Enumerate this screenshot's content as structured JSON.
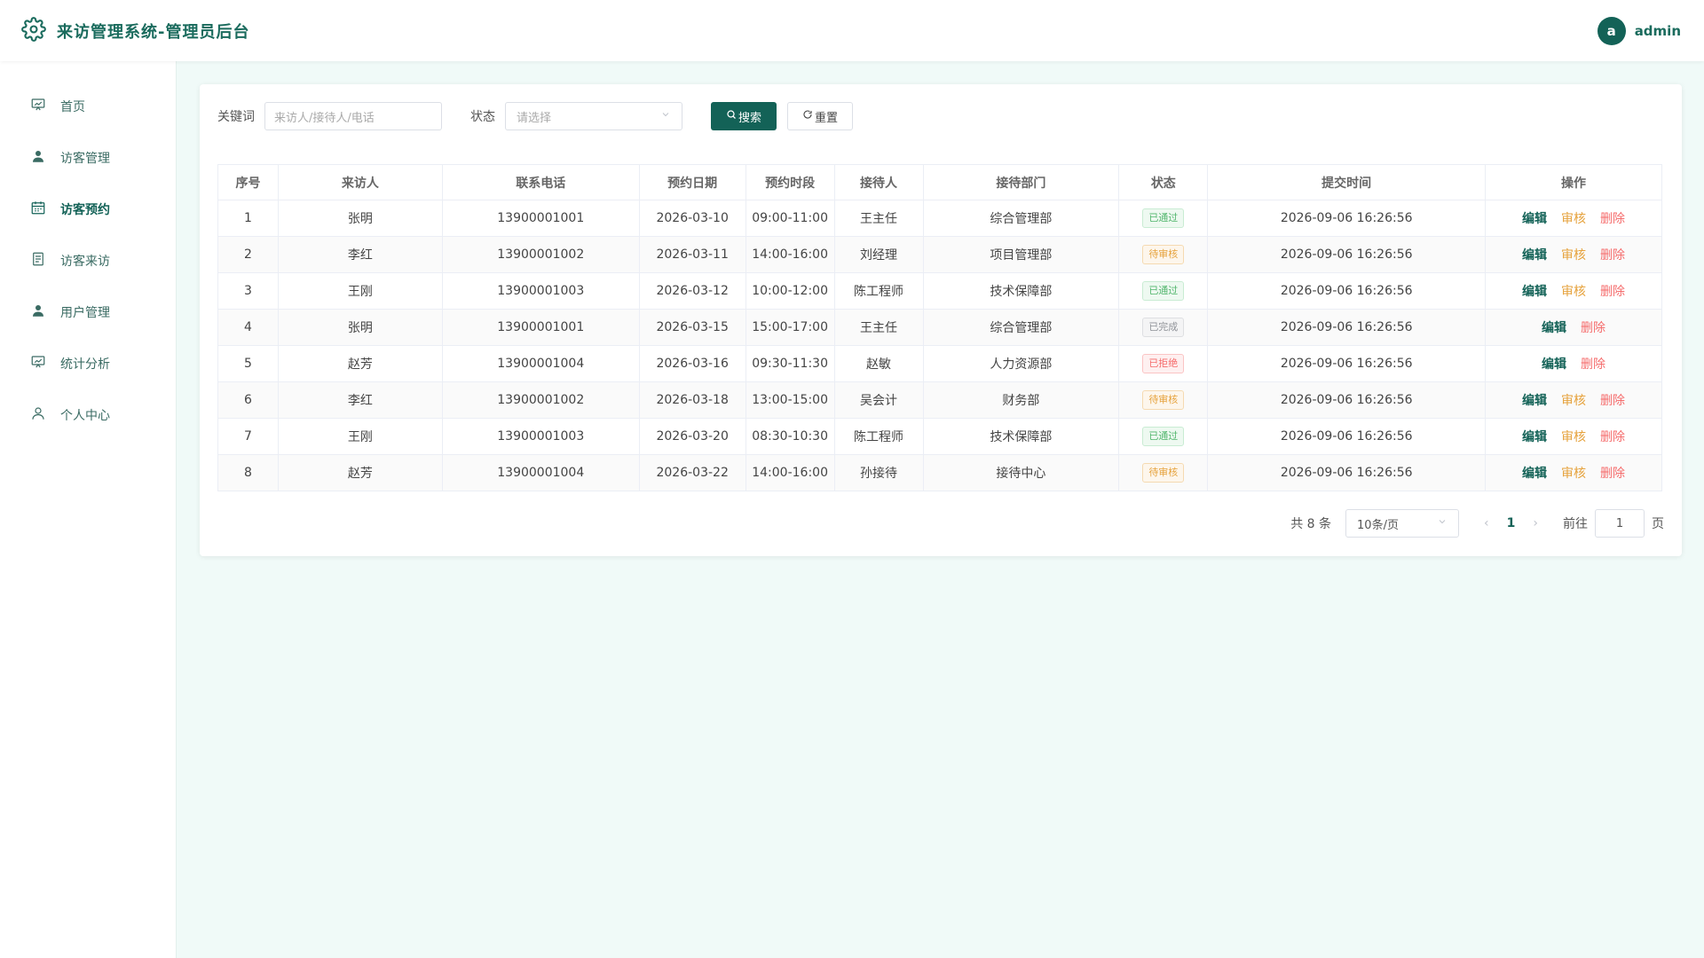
{
  "header": {
    "title": "来访管理系统-管理员后台",
    "avatar_letter": "a",
    "username": "admin"
  },
  "sidebar": {
    "items": [
      {
        "label": "首页",
        "icon": "dashboard-icon"
      },
      {
        "label": "访客管理",
        "icon": "user-icon"
      },
      {
        "label": "访客预约",
        "icon": "calendar-icon",
        "active": true
      },
      {
        "label": "访客来访",
        "icon": "document-icon"
      },
      {
        "label": "用户管理",
        "icon": "user-icon"
      },
      {
        "label": "统计分析",
        "icon": "chart-icon"
      },
      {
        "label": "个人中心",
        "icon": "profile-icon"
      }
    ]
  },
  "filters": {
    "keyword_label": "关键词",
    "keyword_placeholder": "来访人/接待人/电话",
    "status_label": "状态",
    "status_placeholder": "请选择",
    "search_label": "搜索",
    "reset_label": "重置"
  },
  "table": {
    "columns": [
      "序号",
      "来访人",
      "联系电话",
      "预约日期",
      "预约时段",
      "接待人",
      "接待部门",
      "状态",
      "提交时间",
      "操作"
    ],
    "rows": [
      {
        "no": "1",
        "visitor": "张明",
        "phone": "13900001001",
        "date": "2026-03-10",
        "slot": "09:00-11:00",
        "host": "王主任",
        "dept": "综合管理部",
        "status": "已通过",
        "status_type": "ok",
        "submitted": "2026-09-06 16:26:56",
        "actions": [
          "编辑",
          "审核",
          "删除"
        ]
      },
      {
        "no": "2",
        "visitor": "李红",
        "phone": "13900001002",
        "date": "2026-03-11",
        "slot": "14:00-16:00",
        "host": "刘经理",
        "dept": "项目管理部",
        "status": "待审核",
        "status_type": "wait",
        "submitted": "2026-09-06 16:26:56",
        "actions": [
          "编辑",
          "审核",
          "删除"
        ]
      },
      {
        "no": "3",
        "visitor": "王刚",
        "phone": "13900001003",
        "date": "2026-03-12",
        "slot": "10:00-12:00",
        "host": "陈工程师",
        "dept": "技术保障部",
        "status": "已通过",
        "status_type": "ok",
        "submitted": "2026-09-06 16:26:56",
        "actions": [
          "编辑",
          "审核",
          "删除"
        ]
      },
      {
        "no": "4",
        "visitor": "张明",
        "phone": "13900001001",
        "date": "2026-03-15",
        "slot": "15:00-17:00",
        "host": "王主任",
        "dept": "综合管理部",
        "status": "已完成",
        "status_type": "done",
        "submitted": "2026-09-06 16:26:56",
        "actions": [
          "编辑",
          "删除"
        ]
      },
      {
        "no": "5",
        "visitor": "赵芳",
        "phone": "13900001004",
        "date": "2026-03-16",
        "slot": "09:30-11:30",
        "host": "赵敏",
        "dept": "人力资源部",
        "status": "已拒绝",
        "status_type": "rej",
        "submitted": "2026-09-06 16:26:56",
        "actions": [
          "编辑",
          "删除"
        ]
      },
      {
        "no": "6",
        "visitor": "李红",
        "phone": "13900001002",
        "date": "2026-03-18",
        "slot": "13:00-15:00",
        "host": "吴会计",
        "dept": "财务部",
        "status": "待审核",
        "status_type": "wait",
        "submitted": "2026-09-06 16:26:56",
        "actions": [
          "编辑",
          "审核",
          "删除"
        ]
      },
      {
        "no": "7",
        "visitor": "王刚",
        "phone": "13900001003",
        "date": "2026-03-20",
        "slot": "08:30-10:30",
        "host": "陈工程师",
        "dept": "技术保障部",
        "status": "已通过",
        "status_type": "ok",
        "submitted": "2026-09-06 16:26:56",
        "actions": [
          "编辑",
          "审核",
          "删除"
        ]
      },
      {
        "no": "8",
        "visitor": "赵芳",
        "phone": "13900001004",
        "date": "2026-03-22",
        "slot": "14:00-16:00",
        "host": "孙接待",
        "dept": "接待中心",
        "status": "待审核",
        "status_type": "wait",
        "submitted": "2026-09-06 16:26:56",
        "actions": [
          "编辑",
          "审核",
          "删除"
        ]
      }
    ]
  },
  "pagination": {
    "total_text": "共 8 条",
    "page_size": "10条/页",
    "current_page": "1",
    "goto_label": "前往",
    "goto_value": "1",
    "page_suffix": "页"
  },
  "colors": {
    "primary": "#136257",
    "background": "#f0faf8",
    "warning": "#e6a23c",
    "danger": "#f56c6c",
    "success": "#52b66d"
  }
}
